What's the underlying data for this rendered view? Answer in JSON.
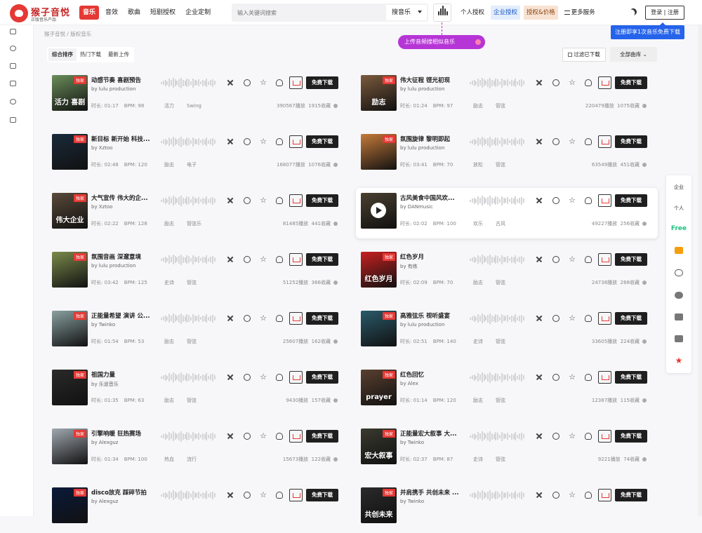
{
  "header": {
    "logo_name": "猴子音悦",
    "logo_slogan": "正版音乐产品",
    "nav": [
      "音乐",
      "音效",
      "歌曲",
      "短剧授权",
      "企业定制"
    ],
    "search_placeholder": "输入关键词搜索",
    "search_type": "搜音乐",
    "top_links": {
      "personal": "个人授权",
      "enterprise": "企业授权",
      "pricing": "授权&价格",
      "more": "更多服务"
    },
    "login": "登录 | 注册",
    "register_tip": "注册即享1次音乐免费下载",
    "upload_tip": "上传音频搜相似音乐"
  },
  "breadcrumb": "猴子音悦 / 版权音乐",
  "tabs": [
    "综合排序",
    "热门下载",
    "最新上传"
  ],
  "filter_downloaded": "过滤已下载",
  "library_select": "全部曲库",
  "download_label": "免费下载",
  "exclusive_label": "独家",
  "right_bar": {
    "enterprise": "企业",
    "personal": "个人",
    "free": "Free"
  },
  "colors": {
    "accent": "#e53935",
    "enterprise_blue": "#2563eb",
    "upload_purple": "#b635d6",
    "free_green": "#19c37d"
  },
  "tracks": [
    {
      "title": "动感节奏 喜剧预告",
      "author": "by lulu production",
      "duration": "时长: 01:17",
      "bpm": "BPM: 98",
      "tags": [
        "活力",
        "Swing"
      ],
      "plays": "390567播放",
      "favs": "1915收藏",
      "cover_text": "活力 喜剧",
      "cover_color": "#6a8d5a",
      "exclusive": true
    },
    {
      "title": "伟大征程 铿光初现",
      "author": "by lulu production",
      "duration": "时长: 01:24",
      "bpm": "BPM: 97",
      "tags": [
        "励志",
        "管弦"
      ],
      "plays": "220479播放",
      "favs": "1075收藏",
      "cover_text": "励志",
      "cover_color": "#7b5a3c",
      "exclusive": true
    },
    {
      "title": "新目标 新开始 科技...",
      "author": "by Xztoo",
      "duration": "时长: 02:48",
      "bpm": "BPM: 120",
      "tags": [
        "励志",
        "电子"
      ],
      "plays": "168077播放",
      "favs": "1076收藏",
      "cover_text": "",
      "cover_color": "#1a2a3a",
      "exclusive": true
    },
    {
      "title": "氛围旋律 黎明即起",
      "author": "by lulu production",
      "duration": "时长: 03:41",
      "bpm": "BPM: 70",
      "tags": [
        "放松",
        "管弦"
      ],
      "plays": "63549播放",
      "favs": "451收藏",
      "cover_text": "",
      "cover_color": "#c57a3a",
      "exclusive": true
    },
    {
      "title": "大气宣传 伟大的企...",
      "author": "by Xztoo",
      "duration": "时长: 02:22",
      "bpm": "BPM: 128",
      "tags": [
        "励志",
        "管弦乐"
      ],
      "plays": "81485播放",
      "favs": "441收藏",
      "cover_text": "伟大企业",
      "cover_color": "#5a4a3a",
      "exclusive": true
    },
    {
      "title": "古风美食中国风欢...",
      "author": "by DANmusic",
      "duration": "时长: 02:02",
      "bpm": "BPM: 100",
      "tags": [
        "欢乐",
        "古风"
      ],
      "plays": "49227播放",
      "favs": "256收藏",
      "cover_text": "",
      "cover_color": "#4a4030",
      "exclusive": false
    },
    {
      "title": "氛围音画 深邃意境",
      "author": "by lulu production",
      "duration": "时长: 03:42",
      "bpm": "BPM: 125",
      "tags": [
        "史诗",
        "管弦"
      ],
      "plays": "51252播放",
      "favs": "366收藏",
      "cover_text": "",
      "cover_color": "#7a8a4a",
      "exclusive": true
    },
    {
      "title": "红色岁月",
      "author": "by 有练",
      "duration": "时长: 02:09",
      "bpm": "BPM: 70",
      "tags": [
        "励志",
        "管弦"
      ],
      "plays": "24738播放",
      "favs": "268收藏",
      "cover_text": "红色岁月",
      "cover_color": "#c82020",
      "exclusive": true
    },
    {
      "title": "正能量希望 演讲 公...",
      "author": "by Twinko",
      "duration": "时长: 01:54",
      "bpm": "BPM: 53",
      "tags": [
        "励志",
        "管弦"
      ],
      "plays": "25607播放",
      "favs": "162收藏",
      "cover_text": "",
      "cover_color": "#8aa0a0",
      "exclusive": true
    },
    {
      "title": "高雅弦乐 视听盛宴",
      "author": "by lulu production",
      "duration": "时长: 02:51",
      "bpm": "BPM: 140",
      "tags": [
        "史诗",
        "管弦"
      ],
      "plays": "33605播放",
      "favs": "224收藏",
      "cover_text": "",
      "cover_color": "#2a5a6a",
      "exclusive": true
    },
    {
      "title": "祖国力量",
      "author": "by 乐遥音乐",
      "duration": "时长: 01:35",
      "bpm": "BPM: 63",
      "tags": [
        "励志",
        "管弦"
      ],
      "plays": "9430播放",
      "favs": "157收藏",
      "cover_text": "",
      "cover_color": "#2a2a2a",
      "exclusive": true
    },
    {
      "title": "红色回忆",
      "author": "by Alex",
      "duration": "时长: 01:14",
      "bpm": "BPM: 120",
      "tags": [
        "励志",
        "管弦"
      ],
      "plays": "12387播放",
      "favs": "115收藏",
      "cover_text": "prayer",
      "cover_color": "#5a4030",
      "exclusive": true
    },
    {
      "title": "引擎响暖 狂热赛场",
      "author": "by Alexguz",
      "duration": "时长: 01:34",
      "bpm": "BPM: 100",
      "tags": [
        "热血",
        "流行"
      ],
      "plays": "15673播放",
      "favs": "122收藏",
      "cover_text": "",
      "cover_color": "#a0a8b0",
      "exclusive": true
    },
    {
      "title": "正能量宏大叙事 大...",
      "author": "by Twinko",
      "duration": "时长: 02:37",
      "bpm": "BPM: 87",
      "tags": [
        "史诗",
        "管弦"
      ],
      "plays": "9221播放",
      "favs": "74收藏",
      "cover_text": "宏大叙事",
      "cover_color": "#3a3a30",
      "exclusive": true
    },
    {
      "title": "disco放克 踩碎节拍",
      "author": "by Alexguz",
      "duration": "",
      "bpm": "",
      "tags": [
        "",
        ""
      ],
      "plays": "",
      "favs": "",
      "cover_text": "",
      "cover_color": "#0a1a3a",
      "exclusive": true
    },
    {
      "title": "并肩携手 共创未来 ...",
      "author": "by Twinko",
      "duration": "",
      "bpm": "",
      "tags": [
        "",
        ""
      ],
      "plays": "",
      "favs": "",
      "cover_text": "共创未来",
      "cover_color": "#2a2a2a",
      "exclusive": true
    }
  ]
}
